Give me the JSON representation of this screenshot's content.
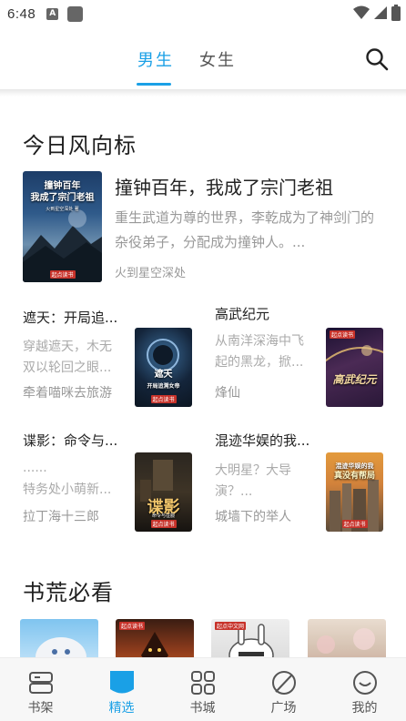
{
  "status_bar": {
    "time": "6:48",
    "notif_letter": "A"
  },
  "top_tabs": [
    {
      "label": "男生",
      "active": true
    },
    {
      "label": "女生",
      "active": false
    }
  ],
  "sections": {
    "daily": {
      "title": "今日风向标"
    },
    "must_read": {
      "title": "书荒必看"
    }
  },
  "featured": {
    "title": "撞钟百年，我成了宗门老祖",
    "desc": "重生武道为尊的世界，李乾成为了神剑门的杂役弟子，分配成为撞钟人。...",
    "author": "火到星空深处",
    "cover": {
      "title": "撞钟百年\n我成了宗门老祖",
      "sub": "火到星空深处 著",
      "logo": "起点读书"
    }
  },
  "items": [
    {
      "title": "遮天：开局追...",
      "desc": "穿越遮天，木无双以轮回之眼...",
      "author": "牵着喵咪去旅游",
      "cover_text": "遮天\n开局追溯女帝",
      "cover_sub": "牵着喵咪去旅游",
      "logo": "起点读书"
    },
    {
      "title": "高武纪元",
      "desc": "从南洋深海中飞起的黑龙，掀...",
      "author": "烽仙",
      "cover_text": "高武纪元",
      "cover_sub": "",
      "logo": "起点读书"
    },
    {
      "title": "谍影：命令与...",
      "desc": "......",
      "author": "特务处小萌新...",
      "author2": "拉丁海十三郎",
      "cover_text": "谍影",
      "cover_sub": "命令与征服",
      "logo": "起点读书"
    },
    {
      "title": "混迹华娱的我...",
      "desc": "大明星？大导演？...",
      "author": "城墙下的举人",
      "cover_text": "混迹华娱的我\n真没有帮局",
      "cover_sub": "",
      "logo": "起点读书"
    }
  ],
  "bottom_books": [
    {
      "logo": ""
    },
    {
      "logo": "起点读书"
    },
    {
      "logo": "起点中文网"
    },
    {
      "logo": ""
    }
  ],
  "bottom_nav": [
    {
      "label": "书架",
      "icon": "bookshelf-icon",
      "active": false
    },
    {
      "label": "精选",
      "icon": "featured-icon",
      "active": true
    },
    {
      "label": "书城",
      "icon": "bookstore-icon",
      "active": false
    },
    {
      "label": "广场",
      "icon": "plaza-icon",
      "active": false
    },
    {
      "label": "我的",
      "icon": "profile-icon",
      "active": false
    }
  ],
  "colors": {
    "accent": "#1aa0e6",
    "text_primary": "#222222",
    "text_secondary": "#999999"
  }
}
